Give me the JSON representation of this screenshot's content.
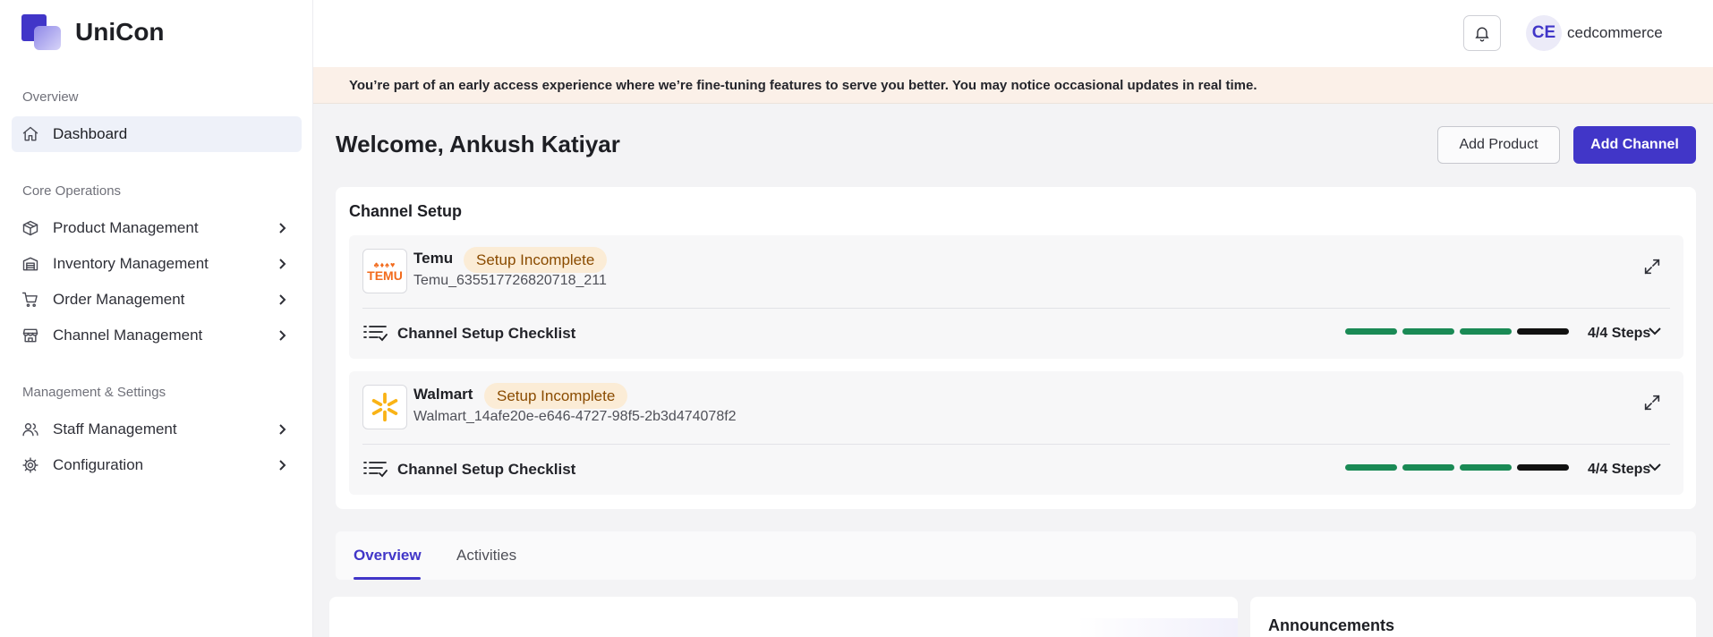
{
  "app": {
    "name": "UniCon"
  },
  "sidebar": {
    "sections": [
      {
        "label": "Overview"
      },
      {
        "label": "Core Operations"
      },
      {
        "label": "Management & Settings"
      }
    ],
    "items": [
      {
        "label": "Dashboard",
        "icon": "home-icon",
        "active": true
      },
      {
        "label": "Product Management",
        "icon": "box-icon"
      },
      {
        "label": "Inventory Management",
        "icon": "warehouse-icon"
      },
      {
        "label": "Order Management",
        "icon": "cart-icon"
      },
      {
        "label": "Channel Management",
        "icon": "store-icon"
      },
      {
        "label": "Staff Management",
        "icon": "users-icon"
      },
      {
        "label": "Configuration",
        "icon": "gear-icon"
      }
    ]
  },
  "header": {
    "user_initials": "CE",
    "username": "cedcommerce"
  },
  "banner": {
    "text": "You’re part of an early access experience where we’re fine-tuning features to serve you better. You may notice occasional updates in real time."
  },
  "welcome": {
    "title": "Welcome, Ankush Katiyar",
    "add_product": "Add Product",
    "add_channel": "Add Channel"
  },
  "channel_setup": {
    "title": "Channel Setup",
    "channels": [
      {
        "name": "Temu",
        "status": "Setup Incomplete",
        "id": "Temu_635517726820718_211",
        "logo_text": "TEMU",
        "checklist_label": "Channel Setup Checklist",
        "steps_label": "4/4 Steps",
        "steps_done": 4,
        "steps_total": 4
      },
      {
        "name": "Walmart",
        "status": "Setup Incomplete",
        "id": "Walmart_14afe20e-e646-4727-98f5-2b3d474078f2",
        "checklist_label": "Channel Setup Checklist",
        "steps_label": "4/4 Steps",
        "steps_done": 4,
        "steps_total": 4
      }
    ]
  },
  "tabs": [
    {
      "label": "Overview",
      "active": true
    },
    {
      "label": "Activities"
    }
  ],
  "announcements": {
    "title": "Announcements"
  },
  "colors": {
    "accent": "#4136c8",
    "step_green": "#1a8a55",
    "step_black": "#111111",
    "badge_bg": "#fbecd6",
    "banner_bg": "#fbf0e8"
  }
}
